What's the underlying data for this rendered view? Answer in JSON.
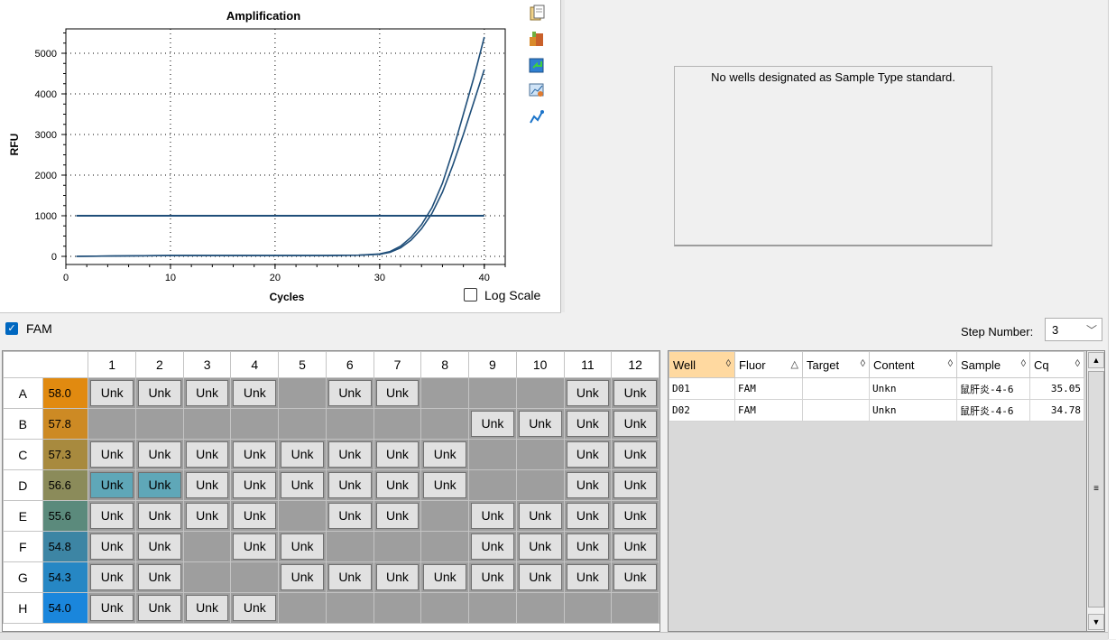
{
  "chart": {
    "title": "Amplification",
    "ylabel": "RFU",
    "xlabel": "Cycles",
    "log_scale_label": "Log Scale",
    "log_scale_checked": false,
    "line_color": "#1f4e79",
    "threshold_color": "#1f4e79"
  },
  "chart_data": {
    "type": "line",
    "title": "Amplification",
    "xlabel": "Cycles",
    "ylabel": "RFU",
    "xlim": [
      0,
      42
    ],
    "ylim": [
      -200,
      5600
    ],
    "xticks": [
      0,
      10,
      20,
      30,
      40
    ],
    "yticks": [
      0,
      1000,
      2000,
      3000,
      4000,
      5000
    ],
    "grid": true,
    "threshold": 1000,
    "series": [
      {
        "x": [
          1,
          5,
          10,
          15,
          20,
          25,
          28,
          30,
          31,
          32,
          33,
          34,
          35,
          36,
          37,
          38,
          39,
          40
        ],
        "values": [
          0,
          10,
          20,
          20,
          20,
          20,
          30,
          60,
          120,
          250,
          470,
          780,
          1200,
          1800,
          2600,
          3500,
          4400,
          5400
        ]
      },
      {
        "x": [
          1,
          5,
          10,
          15,
          20,
          25,
          28,
          30,
          31,
          32,
          33,
          34,
          35,
          36,
          37,
          38,
          39,
          40
        ],
        "values": [
          0,
          10,
          20,
          20,
          20,
          20,
          30,
          50,
          100,
          210,
          400,
          680,
          1060,
          1580,
          2250,
          3000,
          3800,
          4600
        ]
      }
    ]
  },
  "toolbar": {
    "icons": [
      "copy-icon",
      "export-icon",
      "refresh-icon",
      "chart-settings-icon",
      "trace-icon"
    ]
  },
  "standard_curve": {
    "message": "No wells designated as Sample Type standard."
  },
  "fluor": {
    "label": "FAM",
    "checked": true
  },
  "step": {
    "label": "Step Number:",
    "value": "3"
  },
  "plate": {
    "columns": [
      "1",
      "2",
      "3",
      "4",
      "5",
      "6",
      "7",
      "8",
      "9",
      "10",
      "11",
      "12"
    ],
    "rows": [
      {
        "label": "A",
        "temp": "58.0",
        "temp_color": "#e18a10",
        "wells": [
          "Unk",
          "Unk",
          "Unk",
          "Unk",
          "",
          "Unk",
          "Unk",
          "",
          "",
          "",
          "Unk",
          "Unk"
        ]
      },
      {
        "label": "B",
        "temp": "57.8",
        "temp_color": "#cd8a24",
        "wells": [
          "",
          "",
          "",
          "",
          "",
          "",
          "",
          "",
          "Unk",
          "Unk",
          "Unk",
          "Unk"
        ]
      },
      {
        "label": "C",
        "temp": "57.3",
        "temp_color": "#a88a3e",
        "wells": [
          "Unk",
          "Unk",
          "Unk",
          "Unk",
          "Unk",
          "Unk",
          "Unk",
          "Unk",
          "",
          "",
          "Unk",
          "Unk"
        ]
      },
      {
        "label": "D",
        "temp": "56.6",
        "temp_color": "#8b8b5a",
        "wells": [
          "Unk",
          "Unk",
          "Unk",
          "Unk",
          "Unk",
          "Unk",
          "Unk",
          "Unk",
          "",
          "",
          "Unk",
          "Unk"
        ],
        "selected": [
          0,
          1
        ]
      },
      {
        "label": "E",
        "temp": "55.6",
        "temp_color": "#5b8a7c",
        "wells": [
          "Unk",
          "Unk",
          "Unk",
          "Unk",
          "",
          "Unk",
          "Unk",
          "",
          "Unk",
          "Unk",
          "Unk",
          "Unk"
        ]
      },
      {
        "label": "F",
        "temp": "54.8",
        "temp_color": "#3d85a4",
        "wells": [
          "Unk",
          "Unk",
          "",
          "Unk",
          "Unk",
          "",
          "",
          "",
          "Unk",
          "Unk",
          "Unk",
          "Unk"
        ]
      },
      {
        "label": "G",
        "temp": "54.3",
        "temp_color": "#2687c4",
        "wells": [
          "Unk",
          "Unk",
          "",
          "",
          "Unk",
          "Unk",
          "Unk",
          "Unk",
          "Unk",
          "Unk",
          "Unk",
          "Unk"
        ]
      },
      {
        "label": "H",
        "temp": "54.0",
        "temp_color": "#1a86dc",
        "wells": [
          "Unk",
          "Unk",
          "Unk",
          "Unk",
          "",
          "",
          "",
          "",
          "",
          "",
          "",
          ""
        ]
      }
    ]
  },
  "results": {
    "headers": [
      "Well",
      "Fluor",
      "Target",
      "Content",
      "Sample",
      "Cq"
    ],
    "sort_glyphs": [
      "◊",
      "△",
      "◊",
      "◊",
      "◊",
      "◊"
    ],
    "rows": [
      {
        "well": "D01",
        "fluor": "FAM",
        "target": "",
        "content": "Unkn",
        "sample": "鼠肝炎-4-6",
        "cq": "35.05"
      },
      {
        "well": "D02",
        "fluor": "FAM",
        "target": "",
        "content": "Unkn",
        "sample": "鼠肝炎-4-6",
        "cq": "34.78"
      }
    ]
  }
}
